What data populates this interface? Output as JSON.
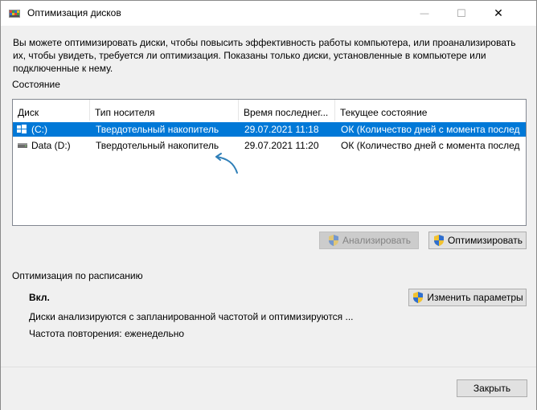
{
  "window": {
    "title": "Оптимизация дисков",
    "controls": {
      "minimize": "—",
      "maximize": "☐",
      "close": "✕"
    }
  },
  "description": "Вы можете оптимизировать диски, чтобы повысить эффективность работы  компьютера, или проанализировать их, чтобы увидеть, требуется ли оптимизация. Показаны только диски, установленные в компьютере или подключенные к нему.",
  "status_section": {
    "label": "Состояние",
    "columns": [
      "Диск",
      "Тип носителя",
      "Время последнег...",
      "Текущее состояние"
    ],
    "rows": [
      {
        "disk": "(C:)",
        "media_type": "Твердотельный накопитель",
        "last_run": "29.07.2021 11:18",
        "status": "ОК (Количество дней с момента послед",
        "selected": true,
        "icon": "windows-drive-icon"
      },
      {
        "disk": "Data (D:)",
        "media_type": "Твердотельный накопитель",
        "last_run": "29.07.2021 11:20",
        "status": "ОК (Количество дней с момента послед",
        "selected": false,
        "icon": "drive-icon"
      }
    ],
    "analyze_button": "Анализировать",
    "optimize_button": "Оптимизировать"
  },
  "schedule_section": {
    "label": "Оптимизация по расписанию",
    "state": "Вкл.",
    "info": "Диски анализируются с запланированной частотой и оптимизируются ...",
    "frequency": "Частота повторения: еженедельно",
    "change_button": "Изменить параметры"
  },
  "close_button": "Закрыть",
  "colors": {
    "selection": "#0078d7",
    "annotation_arrow": "#2f7fb8"
  }
}
